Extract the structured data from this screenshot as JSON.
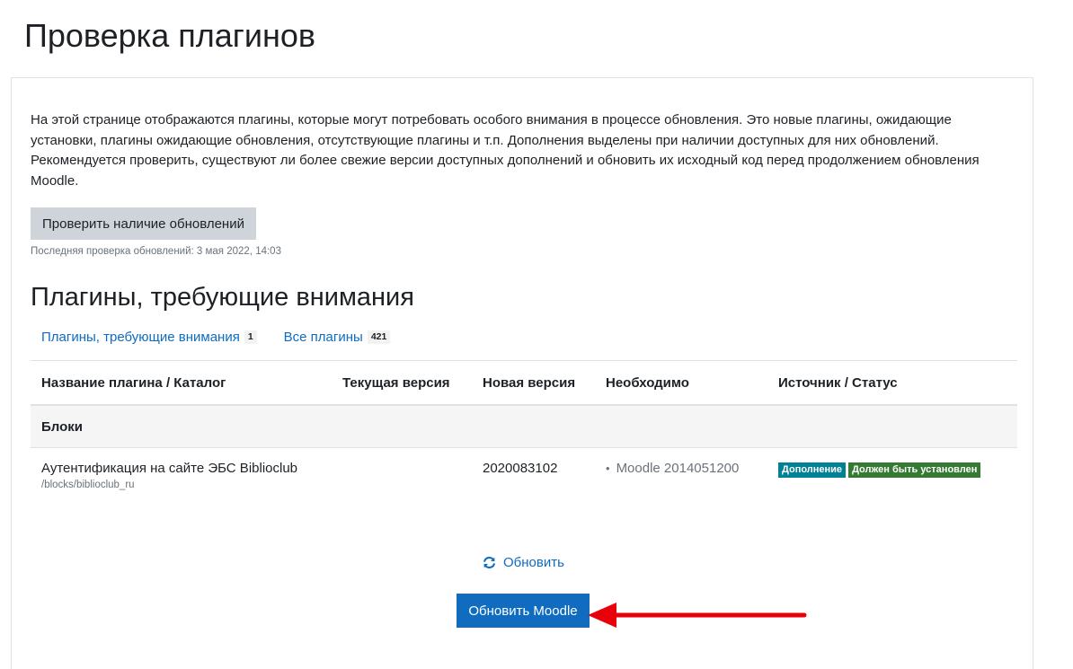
{
  "page": {
    "title": "Проверка плагинов"
  },
  "intro": {
    "text": "На этой странице отображаются плагины, которые могут потребовать особого внимания в процессе обновления. Это новые плагины, ожидающие установки, плагины ожидающие обновления, отсутствующие плагины и т.п. Дополнения выделены при наличии доступных для них обновлений. Рекомендуется проверить, существуют ли более свежие версии доступных дополнений и обновить их исходный код перед продолжением обновления Moodle."
  },
  "check": {
    "button_label": "Проверить наличие обновлений",
    "last_check": "Последняя проверка обновлений: 3 мая 2022, 14:03"
  },
  "section": {
    "title": "Плагины, требующие внимания"
  },
  "filters": [
    {
      "label": "Плагины, требующие внимания",
      "count": "1"
    },
    {
      "label": "Все плагины",
      "count": "421"
    }
  ],
  "table": {
    "headers": [
      "Название плагина / Каталог",
      "Текущая версия",
      "Новая версия",
      "Необходимо",
      "Источник / Статус"
    ],
    "group": "Блоки",
    "rows": [
      {
        "name": "Аутентификация на сайте ЭБС Biblioclub",
        "dir": "/blocks/biblioclub_ru",
        "current_version": "",
        "new_version": "2020083102",
        "requires": "Moodle 2014051200",
        "badges": [
          "Дополнение",
          "Должен быть установлен"
        ]
      }
    ]
  },
  "actions": {
    "refresh_label": "Обновить",
    "upgrade_label": "Обновить Moodle"
  },
  "colors": {
    "link": "#0f6cbf",
    "primary": "#0f6cbf",
    "badge_info": "#008196",
    "badge_success": "#357a32",
    "annotation_arrow": "#e8000b"
  },
  "icons": {
    "refresh": "refresh-icon",
    "annotation": "arrow-left-icon"
  }
}
